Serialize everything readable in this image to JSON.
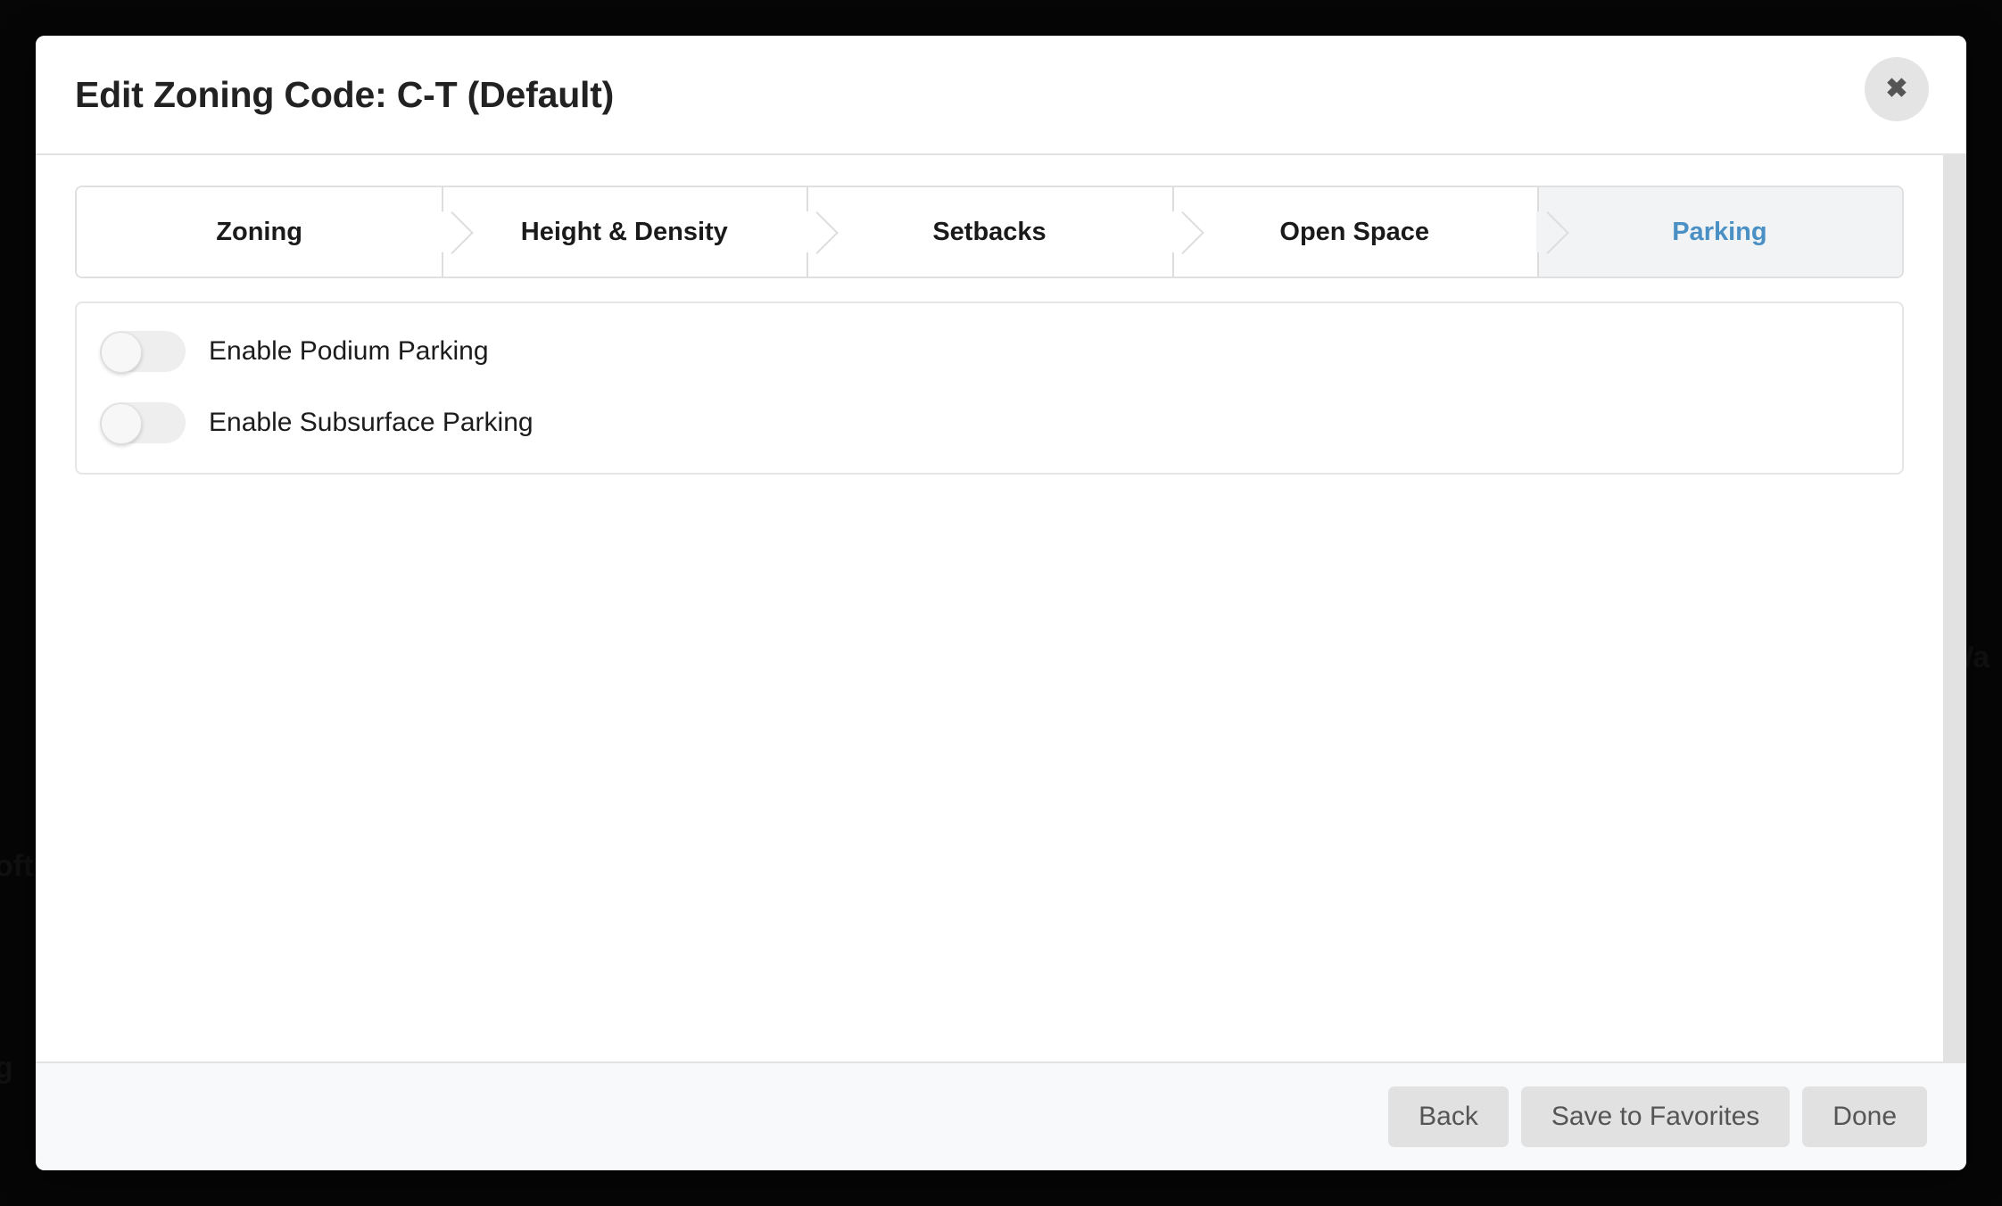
{
  "backdrop": {
    "ghost_fragments": [
      "oft",
      "g",
      "t Wa"
    ]
  },
  "modal": {
    "title": "Edit Zoning Code: C-T (Default)",
    "close_icon": "close-icon",
    "close_glyph": "✖",
    "tabs": [
      {
        "label": "Zoning",
        "active": false
      },
      {
        "label": "Height & Density",
        "active": false
      },
      {
        "label": "Setbacks",
        "active": false
      },
      {
        "label": "Open Space",
        "active": false
      },
      {
        "label": "Parking",
        "active": true
      }
    ],
    "active_tab": "Parking",
    "settings": [
      {
        "label": "Enable Podium Parking",
        "enabled": false
      },
      {
        "label": "Enable Subsurface Parking",
        "enabled": false
      }
    ],
    "footer": {
      "back_label": "Back",
      "save_label": "Save to Favorites",
      "done_label": "Done"
    },
    "colors": {
      "accent": "#4a90c4",
      "active_tab_bg": "#f1f3f5",
      "footer_bg": "#f8f9fa",
      "button_bg": "#e1e1e1",
      "toggle_track": "#eeeeee"
    }
  }
}
